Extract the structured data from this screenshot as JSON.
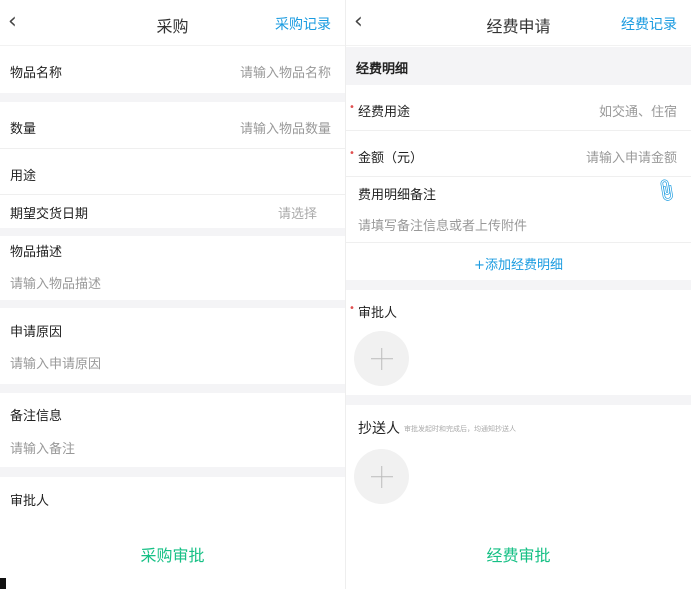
{
  "purchase": {
    "title": "采购",
    "record_link": "采购记录",
    "fields": {
      "item_name": {
        "label": "物品名称",
        "placeholder": "请输入物品名称"
      },
      "quantity": {
        "label": "数量",
        "placeholder": "请输入物品数量"
      },
      "usage": {
        "label": "用途"
      },
      "delivery_date": {
        "label": "期望交货日期",
        "placeholder": "请选择"
      },
      "description": {
        "label": "物品描述",
        "placeholder": "请输入物品描述"
      },
      "reason": {
        "label": "申请原因",
        "placeholder": "请输入申请原因"
      },
      "remark": {
        "label": "备注信息",
        "placeholder": "请输入备注"
      },
      "approver": {
        "label": "审批人"
      }
    },
    "submit_label": "采购审批"
  },
  "expense": {
    "title": "经费申请",
    "record_link": "经费记录",
    "section_title": "经费明细",
    "fields": {
      "purpose": {
        "label": "经费用途",
        "placeholder": "如交通、住宿"
      },
      "amount": {
        "label": "金额（元）",
        "placeholder": "请输入申请金额"
      },
      "note": {
        "label": "费用明细备注",
        "placeholder": "请填写备注信息或者上传附件"
      }
    },
    "add_detail_label": "+添加经费明细",
    "approver_label": "审批人",
    "cc_label": "抄送人",
    "cc_hint": "审批发起时和完成后，均通知抄送人",
    "submit_label": "经费审批"
  },
  "colors": {
    "accent": "#1a9be0",
    "submit": "#16c085",
    "required": "#e05050"
  }
}
